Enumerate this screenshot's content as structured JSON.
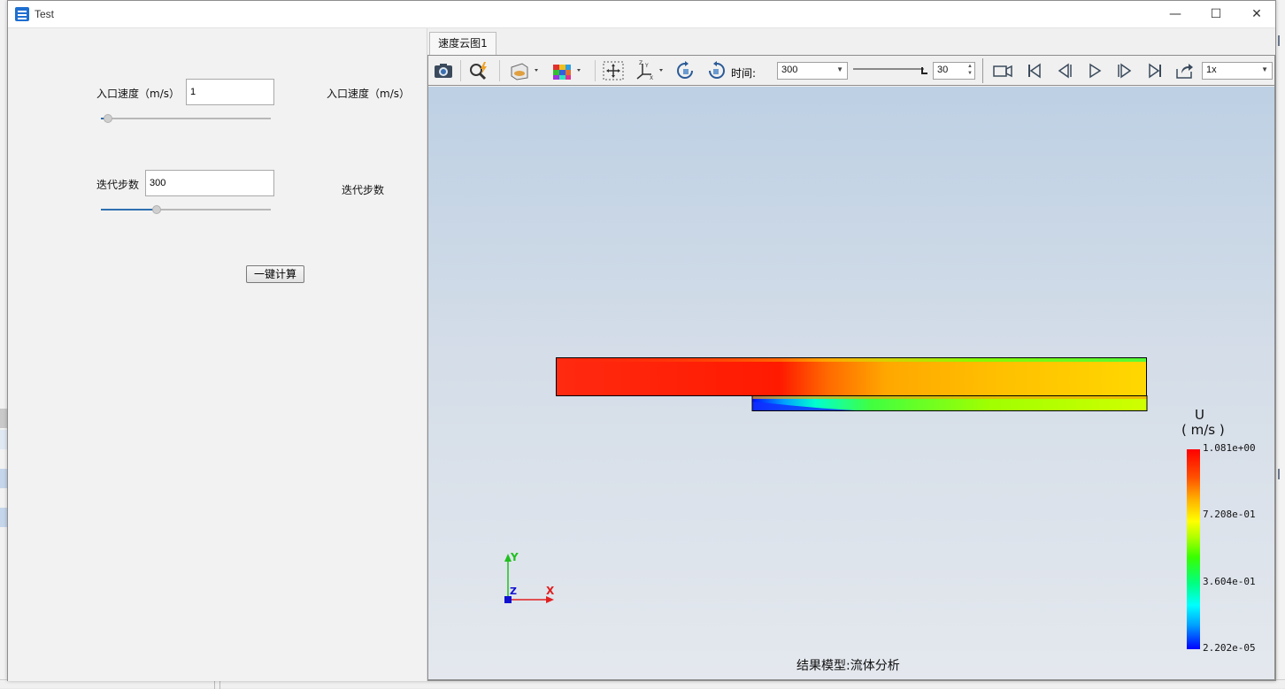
{
  "window": {
    "title": "Test",
    "minimize_glyph": "—",
    "maximize_glyph": "☐",
    "close_glyph": "✕"
  },
  "params": {
    "inlet_velocity": {
      "label": "入口速度（m/s）",
      "value": "1",
      "right_label": "入口速度（m/s）",
      "slider_fraction": 0.04
    },
    "iteration_steps": {
      "label": "迭代步数",
      "value": "300",
      "right_label": "迭代步数",
      "slider_fraction": 0.33
    },
    "compute_button": "一键计算"
  },
  "viewer": {
    "tab_label": "速度云图1",
    "time_label": "时间:",
    "time_value": "300",
    "frame_value": "30",
    "speed_value": "1x",
    "caption": "结果模型:流体分析"
  },
  "legend": {
    "title_line1": "U",
    "title_line2": "( m/s )",
    "ticks": [
      "1.081e+00",
      "7.208e-01",
      "3.604e-01",
      "2.202e-05"
    ]
  },
  "axes": {
    "x": "X",
    "y": "Y",
    "z": "Z"
  },
  "colors": {
    "accent": "#2f6fb0",
    "axis_x": "#e02020",
    "axis_y": "#20c020",
    "axis_z": "#1010d0"
  },
  "icons": [
    "screenshot-icon",
    "zoom-flash-icon",
    "display-mode-icon",
    "colormap-cube-icon",
    "fit-view-icon",
    "axes-orientation-icon",
    "rotate-left-icon",
    "rotate-right-icon",
    "record-icon",
    "first-frame-icon",
    "previous-frame-icon",
    "play-icon",
    "next-frame-icon",
    "last-frame-icon",
    "export-icon"
  ]
}
